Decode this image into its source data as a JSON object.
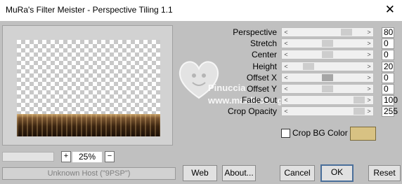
{
  "window": {
    "title": "MuRa's Filter Meister - Perspective Tiling 1.1",
    "close_glyph": "✕"
  },
  "zoom": {
    "plus": "+",
    "minus": "−",
    "value": "25%"
  },
  "status": {
    "text": "Unknown Host (\"9PSP\")"
  },
  "buttons": {
    "web": "Web",
    "about": "About...",
    "cancel": "Cancel",
    "ok": "OK",
    "reset": "Reset"
  },
  "params": [
    {
      "label": "Perspective",
      "value": "80",
      "level": 0.8
    },
    {
      "label": "Stretch",
      "value": "0",
      "level": 0.5
    },
    {
      "label": "Center",
      "value": "0",
      "level": 0.5
    },
    {
      "label": "Height",
      "value": "20",
      "level": 0.2
    },
    {
      "label": "Offset X",
      "value": "0",
      "level": 0.5
    },
    {
      "label": "Offset Y",
      "value": "0",
      "level": 0.5
    },
    {
      "label": "Fade Out",
      "value": "100",
      "level": 1.0
    },
    {
      "label": "Crop Opacity",
      "value": "255",
      "level": 1.0
    }
  ],
  "crop_bg": {
    "label": "Crop BG Color",
    "checked": false,
    "color": "#d8c283"
  },
  "watermark": {
    "line1": "Pinuccia",
    "line2": "www.maidirosa grafica.eu"
  },
  "icons": {
    "arrow_left": "<",
    "arrow_right": ">"
  }
}
